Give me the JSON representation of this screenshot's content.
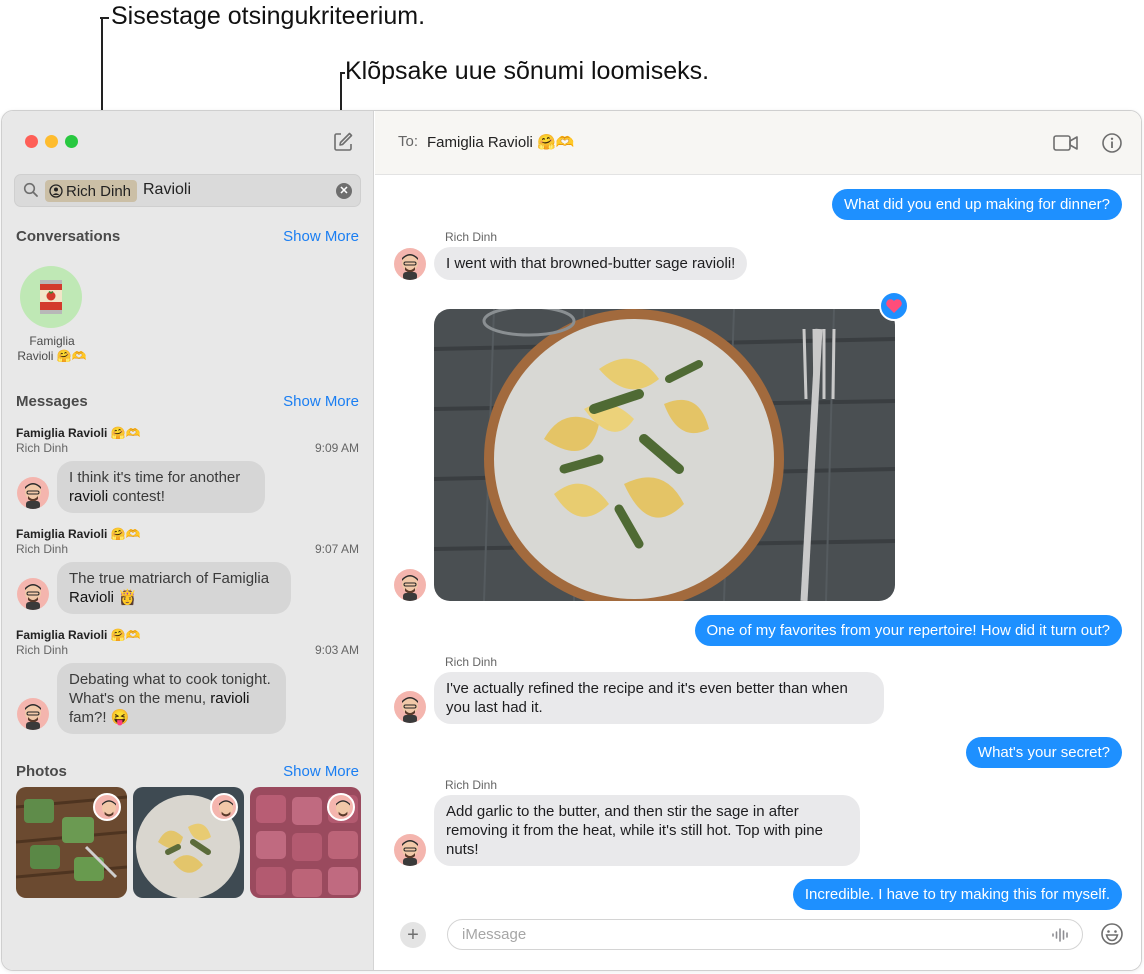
{
  "callouts": {
    "search": "Sisestage otsingukriteerium.",
    "compose": "Klõpsake uue sõnumi loomiseks."
  },
  "colors": {
    "accent": "#1a7ef2",
    "bubble_out": "#1e90ff",
    "bubble_in": "#e9e9eb"
  },
  "sidebar": {
    "search": {
      "token": "Rich Dinh",
      "query": "Ravioli"
    },
    "conversations": {
      "title": "Conversations",
      "show_more": "Show More",
      "item_name": "Famiglia Ravioli 🤗🫶"
    },
    "messages": {
      "title": "Messages",
      "show_more": "Show More",
      "items": [
        {
          "group": "Famiglia Ravioli 🤗🫶",
          "sender": "Rich Dinh",
          "time": "9:09 AM",
          "pre": "I think it's time for another ",
          "hl": "ravioli",
          "post": " contest!"
        },
        {
          "group": "Famiglia Ravioli 🤗🫶",
          "sender": "Rich Dinh",
          "time": "9:07 AM",
          "pre": "The true matriarch of Famiglia ",
          "hl": "Ravioli",
          "post": " 👸"
        },
        {
          "group": "Famiglia Ravioli 🤗🫶",
          "sender": "Rich Dinh",
          "time": "9:03 AM",
          "pre": "Debating what to cook tonight. What's on the menu, ",
          "hl": "ravioli",
          "post": " fam?! 😝"
        }
      ]
    },
    "photos": {
      "title": "Photos",
      "show_more": "Show More"
    }
  },
  "chat": {
    "to_label": "To:",
    "to_name": "Famiglia Ravioli 🤗🫶",
    "messages": {
      "m1": "What did you end up making for dinner?",
      "sender1": "Rich Dinh",
      "m2": "I went with that browned-butter sage ravioli!",
      "m3": "One of my favorites from your repertoire! How did it turn out?",
      "sender2": "Rich Dinh",
      "m4": "I've actually refined the recipe and it's even better than when you last had it.",
      "m5": "What's your secret?",
      "sender3": "Rich Dinh",
      "m6": "Add garlic to the butter, and then stir the sage in after removing it from the heat, while it's still hot. Top with pine nuts!",
      "m7": "Incredible. I have to try making this for myself."
    },
    "input_placeholder": "iMessage"
  }
}
